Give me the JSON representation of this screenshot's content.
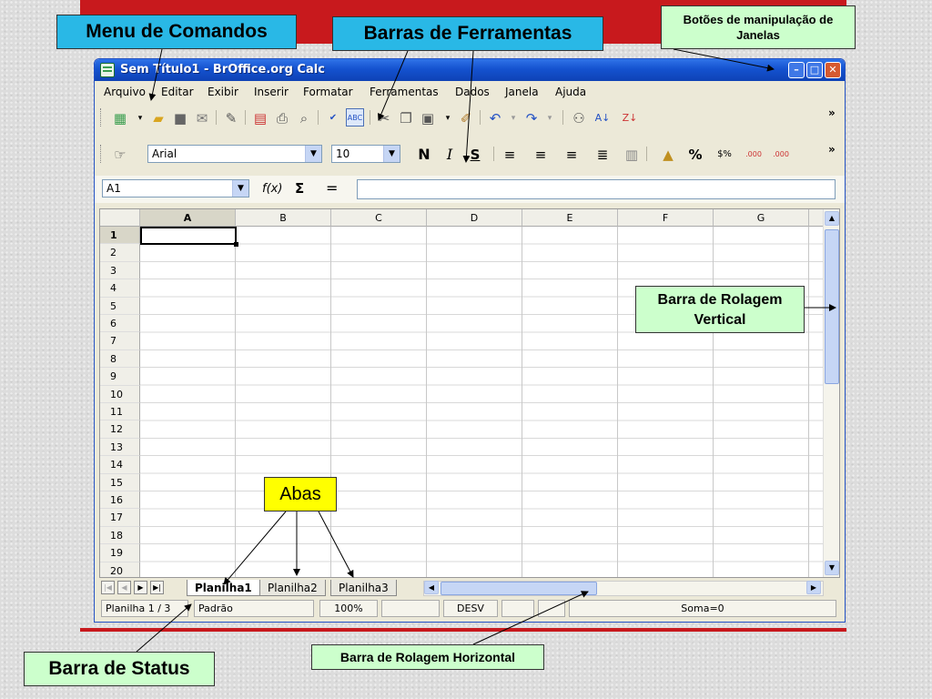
{
  "window": {
    "title": "Sem Título1 - BrOffice.org Calc",
    "min": "–",
    "max": "□",
    "close": "✕"
  },
  "menu": [
    "Arquivo",
    "Editar",
    "Exibir",
    "Inserir",
    "Formatar",
    "Ferramentas",
    "Dados",
    "Janela",
    "Ajuda"
  ],
  "toolbar": {
    "more": "»",
    "undo_label": "↶",
    "redo_label": "↷"
  },
  "format": {
    "font": "Arial",
    "size": "10",
    "bold": "N",
    "italic": "I",
    "underline": "S",
    "percent": "%",
    "currency": "$%",
    "dec_add": ".000",
    "dec_del": ".000"
  },
  "formula": {
    "cell": "A1",
    "fx": "f(x)",
    "sum": "Σ",
    "equals": "="
  },
  "columns": [
    "A",
    "B",
    "C",
    "D",
    "E",
    "F",
    "G"
  ],
  "rows": [
    "1",
    "2",
    "3",
    "4",
    "5",
    "6",
    "7",
    "8",
    "9",
    "10",
    "11",
    "12",
    "13",
    "14",
    "15",
    "16",
    "17",
    "18",
    "19",
    "20"
  ],
  "tabs": [
    "Planilha1",
    "Planilha2",
    "Planilha3"
  ],
  "status": {
    "sheet": "Planilha 1 / 3",
    "style": "Padrão",
    "zoom": "100%",
    "mode": "DESV",
    "sum": "Soma=0"
  },
  "callouts": {
    "menu": "Menu de Comandos",
    "toolbars": "Barras de Ferramentas",
    "window_buttons": "Botões de manipulação de Janelas",
    "vscroll": "Barra de Rolagem Vertical",
    "tabs": "Abas",
    "hscroll": "Barra de Rolagem Horizontal",
    "status": "Barra de Status"
  },
  "colors": {
    "accent_red": "#c8191d",
    "callout_blue": "#29b8e6",
    "callout_green": "#ccffcc",
    "callout_yellow": "#ffff00",
    "titlebar": "#1452cf"
  }
}
